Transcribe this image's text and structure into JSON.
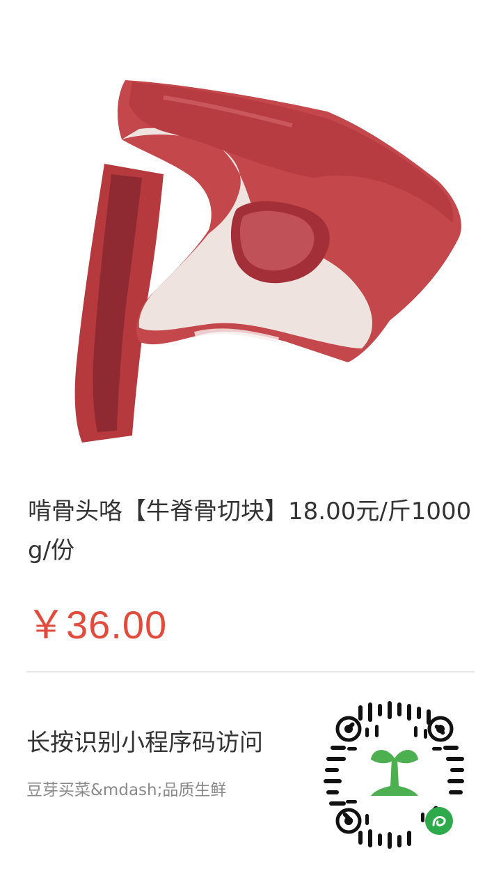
{
  "product": {
    "image_alt": "牛脊骨切块",
    "title": "啃骨头咯【牛脊骨切块】18.00元/斤1000g/份",
    "price": "￥36.00"
  },
  "footer": {
    "qr_tip": "长按识别小程序码访问",
    "shop_name": "豆芽买菜&mdash;品质生鲜"
  },
  "qr": {
    "icon": "mini-program-icon",
    "logo": "sprout-logo",
    "accent_color": "#4caf50"
  },
  "colors": {
    "price": "#e24a3b",
    "text": "#333333",
    "subtext": "#8a8a8a"
  }
}
